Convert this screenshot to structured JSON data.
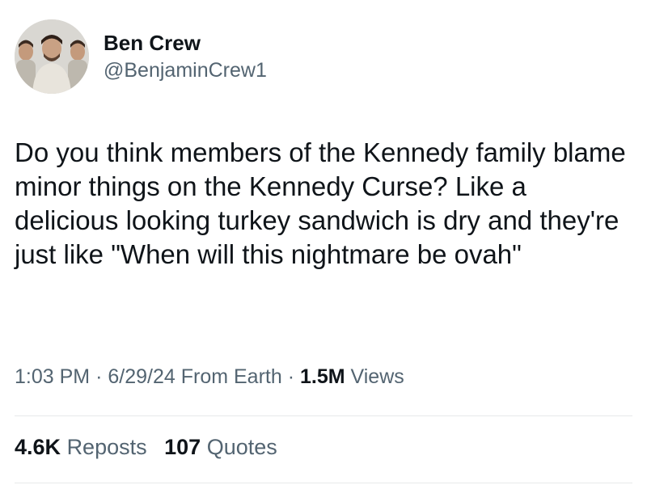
{
  "user": {
    "display_name": "Ben Crew",
    "handle": "@BenjaminCrew1"
  },
  "tweet": {
    "text": "Do you think members of the Kennedy family blame minor things on the Kennedy Curse? Like a delicious looking turkey sandwich is dry and they're just like \"When will this nightmare be ovah\""
  },
  "meta": {
    "time": "1:03 PM",
    "separator": "·",
    "date": "6/29/24",
    "source": "From Earth",
    "views_count": "1.5M",
    "views_label": "Views"
  },
  "stats": {
    "reposts_count": "4.6K",
    "reposts_label": "Reposts",
    "quotes_count": "107",
    "quotes_label": "Quotes"
  },
  "colors": {
    "text_primary": "#0f1419",
    "text_secondary": "#536471",
    "divider": "#e7e9ea"
  }
}
